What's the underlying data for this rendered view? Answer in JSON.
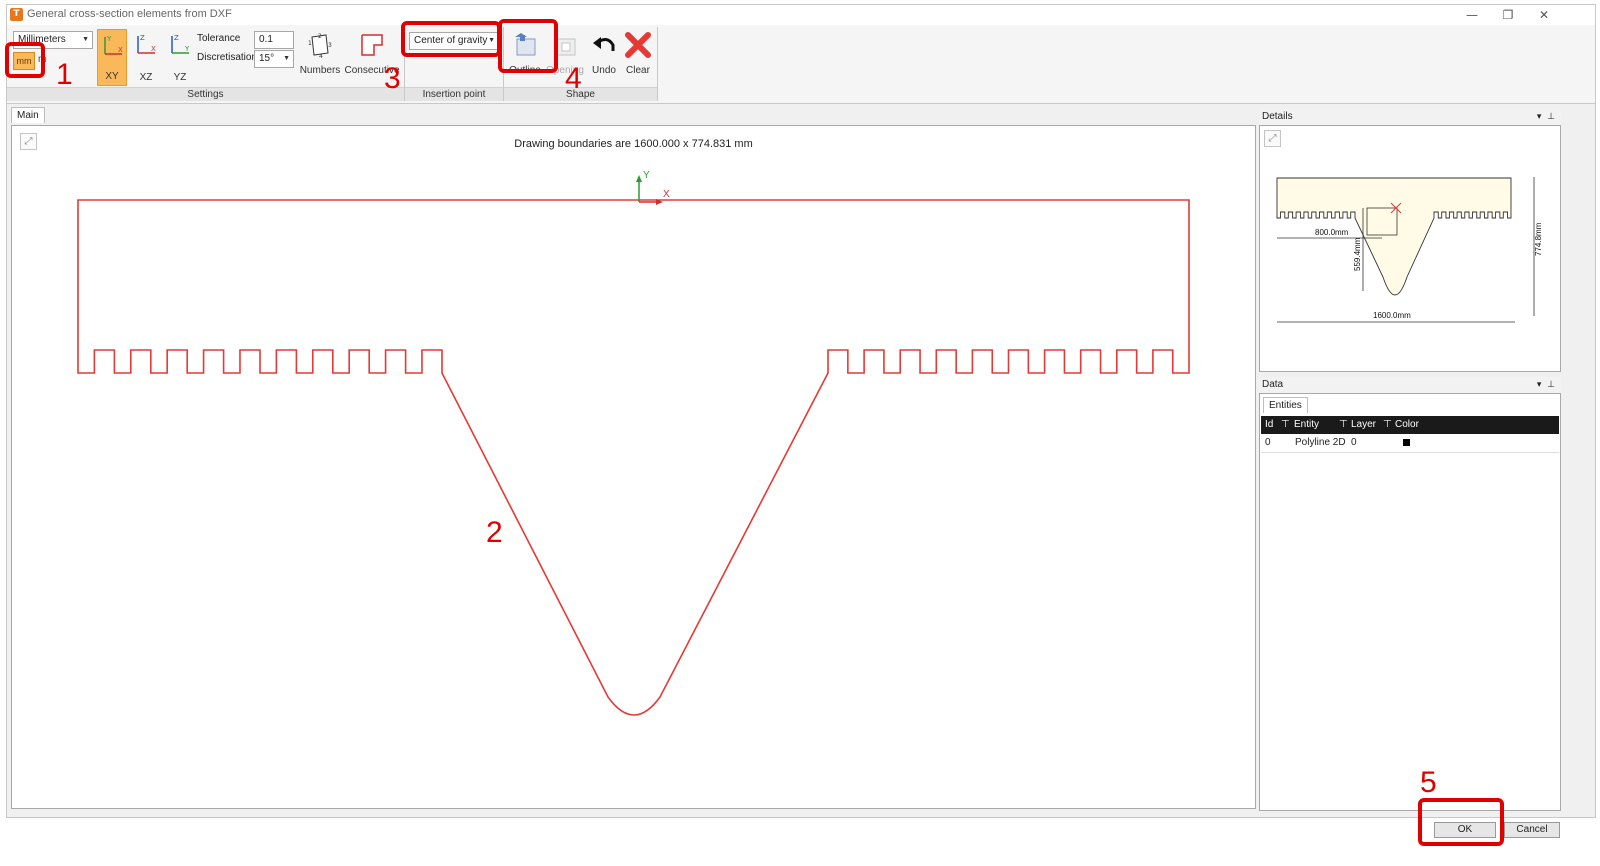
{
  "window": {
    "title": "General cross-section elements from DXF",
    "minimize_glyph": "—",
    "restore_glyph": "❐",
    "close_glyph": "✕"
  },
  "ribbon": {
    "settings": {
      "units_value": "Millimeters",
      "units_button_label": "mm",
      "units_button_suffix": "m",
      "xy_label": "XY",
      "xz_label": "XZ",
      "yz_label": "YZ",
      "tolerance_label": "Tolerance",
      "tolerance_value": "0.1",
      "discretisation_label": "Discretisation",
      "discretisation_value": "15°",
      "numbers_label": "Numbers",
      "consecutive_label": "Consecutive",
      "group_label": "Settings"
    },
    "insertion": {
      "value": "Center of gravity",
      "group_label": "Insertion point"
    },
    "shape": {
      "outline_label": "Outline",
      "opening_label": "Opening",
      "undo_label": "Undo",
      "clear_label": "Clear",
      "group_label": "Shape"
    }
  },
  "main": {
    "tab_label": "Main",
    "boundaries_text": "Drawing boundaries are 1600.000 x 774.831 mm",
    "axis_x": "X",
    "axis_y": "Y"
  },
  "details": {
    "header": "Details",
    "dim_width_half": "800.0mm",
    "dim_width": "1600.0mm",
    "dim_height": "774.8mm",
    "dim_depth": "559.4mm"
  },
  "data": {
    "header": "Data",
    "tab_label": "Entities",
    "columns": [
      "Id",
      "Entity",
      "Layer",
      "Color"
    ],
    "rows": [
      {
        "id": "0",
        "entity": "Polyline 2D",
        "layer": "0",
        "color": "#000000"
      }
    ]
  },
  "footer": {
    "ok_label": "OK",
    "cancel_label": "Cancel"
  },
  "annotations": {
    "step1": "1",
    "step2": "2",
    "step3": "3",
    "step4": "4",
    "step5": "5"
  },
  "colors": {
    "highlight": "#e00000",
    "outline": "#e53935",
    "active_button": "#f9b85a",
    "detail_fill": "#fffbe6"
  }
}
